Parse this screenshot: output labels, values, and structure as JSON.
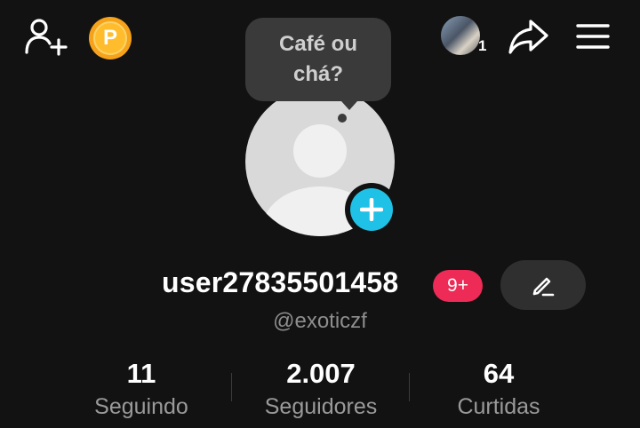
{
  "topbar": {
    "coin_letter": "P",
    "friends_count": "1"
  },
  "bubble": {
    "line1": "Café ou",
    "line2": "chá?"
  },
  "profile": {
    "username": "user27835501458",
    "notification_badge": "9+",
    "handle": "@exoticzf"
  },
  "stats": {
    "following": {
      "value": "11",
      "label": "Seguindo"
    },
    "followers": {
      "value": "2.007",
      "label": "Seguidores"
    },
    "likes": {
      "value": "64",
      "label": "Curtidas"
    }
  },
  "colors": {
    "background": "#121212",
    "accent_blue": "#20c1e6",
    "badge_pink": "#ee2a56",
    "coin_gold": "#f6a21a"
  }
}
